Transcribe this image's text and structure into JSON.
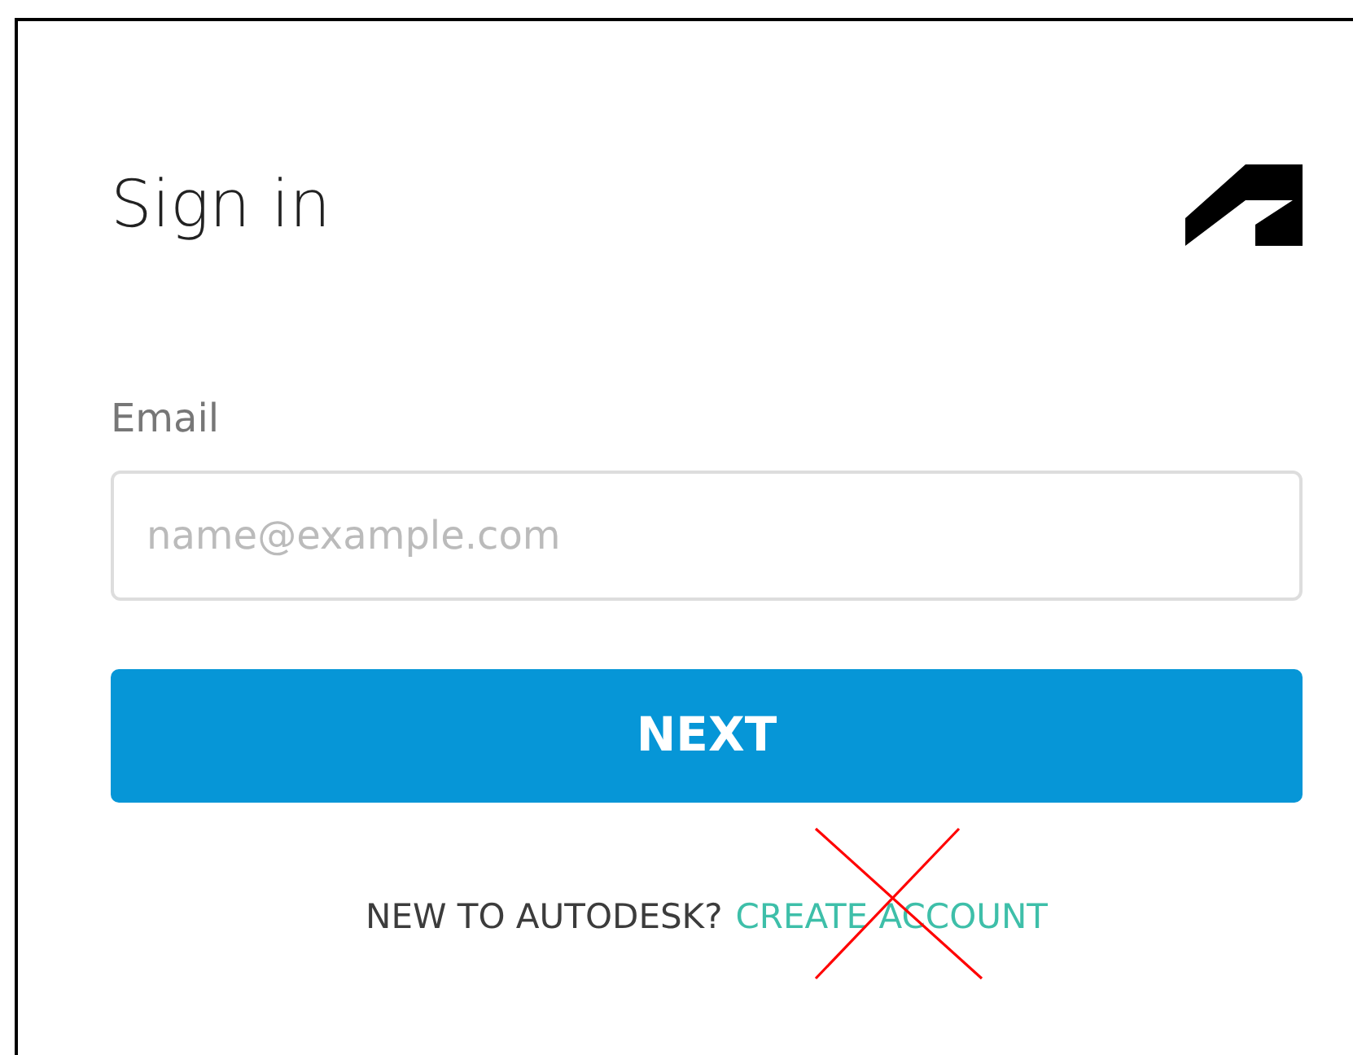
{
  "title": "Sign in",
  "email": {
    "label": "Email",
    "placeholder": "name@example.com"
  },
  "next_button": "NEXT",
  "footer": {
    "prompt": "NEW TO AUTODESK?",
    "link": "CREATE ACCOUNT"
  }
}
